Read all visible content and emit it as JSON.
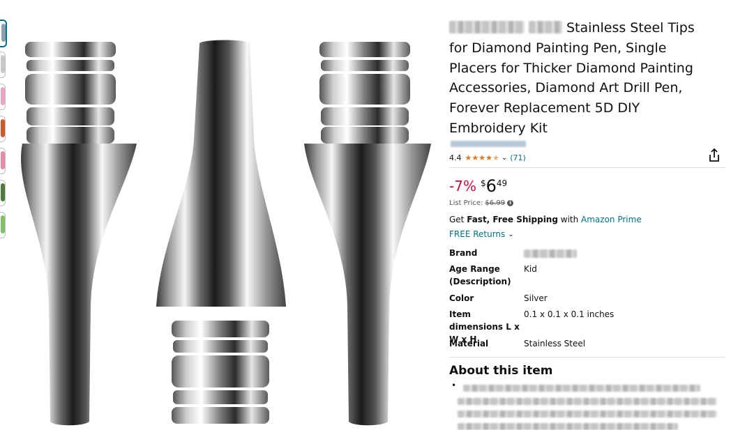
{
  "product": {
    "title": "Stainless Steel Tips for Diamond Painting Pen, Single Placers for Thicker Diamond Painting Accessories, Diamond Art Drill Pen, Forever Replacement 5D DIY Embroidery Kit",
    "rating": "4.4",
    "stars_fraction": 0.88,
    "review_count": "(71)"
  },
  "price": {
    "discount": "-7%",
    "currency": "$",
    "whole": "6",
    "fraction": "49",
    "list_price_label": "List Price:",
    "list_price": "$6.99"
  },
  "shipping": {
    "prefix": "Get ",
    "bold": "Fast, Free Shipping",
    "with": " with ",
    "prime": "Amazon Prime",
    "returns": "FREE Returns"
  },
  "specs": [
    {
      "key": "Brand",
      "value": ""
    },
    {
      "key": "Age Range (Description)",
      "value": "Kid"
    },
    {
      "key": "Color",
      "value": "Silver"
    },
    {
      "key": "Item dimensions L x W x H",
      "value": "0.1 x 0.1 x 0.1 inches"
    },
    {
      "key": "Material",
      "value": "Stainless Steel"
    }
  ],
  "about": {
    "heading": "About this item",
    "bullet": "•"
  },
  "colors": {
    "link": "#007185",
    "discount": "#cc0c39",
    "star": "#de7921",
    "text": "#0f1111",
    "muted": "#565959"
  },
  "icons": {
    "share": "share-icon",
    "chevron": "chevron-down-icon",
    "info": "info-icon"
  }
}
